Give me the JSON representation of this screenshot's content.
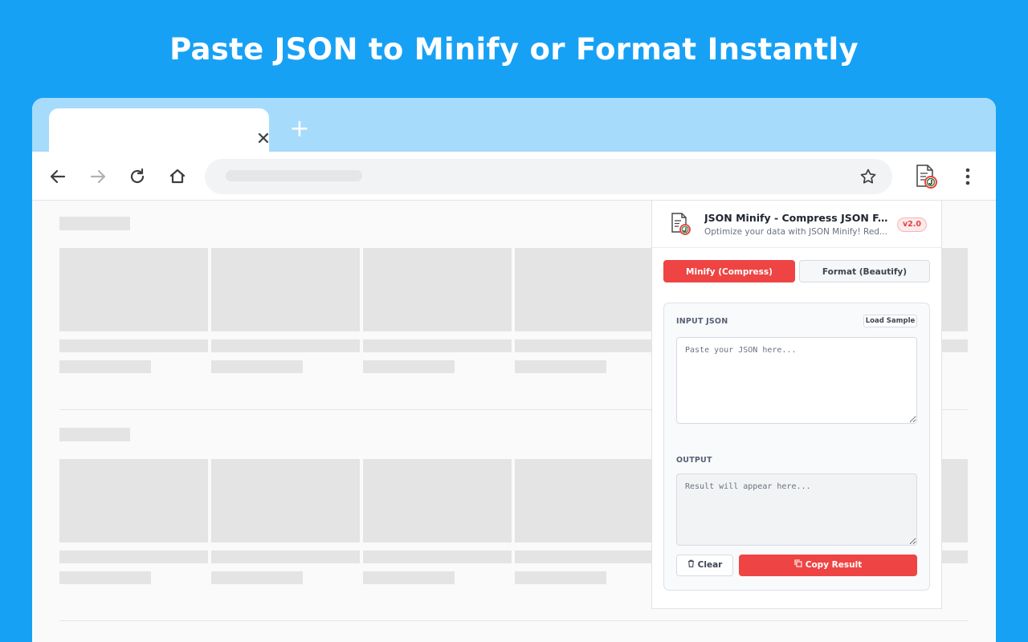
{
  "headline": "Paste JSON to Minify or Format Instantly",
  "browser": {
    "tab_close_glyph": "✕",
    "new_tab_glyph": "+"
  },
  "popup": {
    "title": "JSON Minify - Compress JSON F...",
    "subtitle": "Optimize your data with JSON Minify! Red...",
    "version": "v2.0",
    "modes": {
      "minify_label": "Minify (Compress)",
      "format_label": "Format (Beautify)"
    },
    "input": {
      "label": "INPUT JSON",
      "load_sample": "Load Sample",
      "placeholder": "Paste your JSON here..."
    },
    "output": {
      "label": "OUTPUT",
      "placeholder": "Result will appear here..."
    },
    "clear_label": "Clear",
    "copy_label": "Copy Result"
  },
  "colors": {
    "background": "#17a1f5",
    "tabbar": "#a6dbfb",
    "accent": "#ef4444"
  }
}
